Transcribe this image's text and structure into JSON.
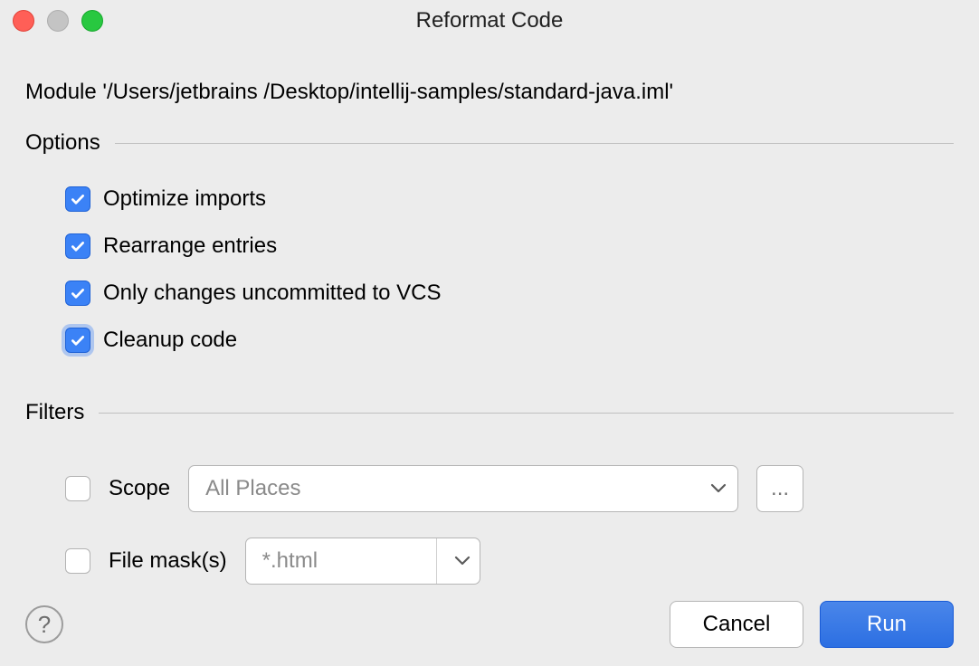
{
  "window": {
    "title": "Reformat Code"
  },
  "module_line": "Module '/Users/jetbrains /Desktop/intellij-samples/standard-java.iml'",
  "options": {
    "title": "Options",
    "items": [
      {
        "label": "Optimize imports",
        "checked": true,
        "focused": false
      },
      {
        "label": "Rearrange entries",
        "checked": true,
        "focused": false
      },
      {
        "label": "Only changes uncommitted to VCS",
        "checked": true,
        "focused": false
      },
      {
        "label": "Cleanup code",
        "checked": true,
        "focused": true
      }
    ]
  },
  "filters": {
    "title": "Filters",
    "scope": {
      "label": "Scope",
      "checked": false,
      "value": "All Places",
      "ellipsis": "..."
    },
    "file_mask": {
      "label": "File mask(s)",
      "checked": false,
      "value": "*.html"
    }
  },
  "buttons": {
    "help": "?",
    "cancel": "Cancel",
    "run": "Run"
  }
}
